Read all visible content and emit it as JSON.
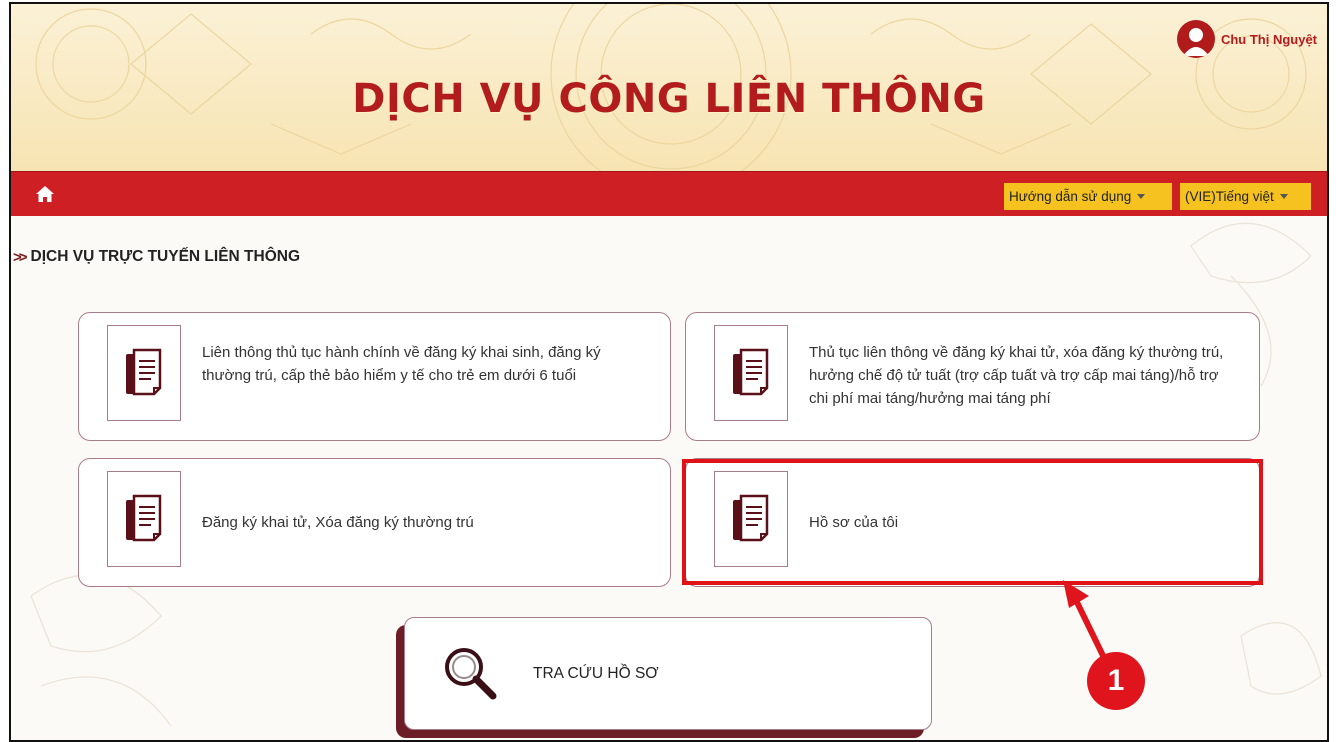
{
  "header": {
    "site_title": "DỊCH VỤ CÔNG LIÊN THÔNG",
    "user_name": "Chu Thị Nguyệt"
  },
  "navbar": {
    "home_icon": "home-icon",
    "guide_label": "Hướng dẫn sử dụng",
    "language_label": "(VIE)Tiếng việt"
  },
  "section": {
    "title": "DỊCH VỤ TRỰC TUYẾN LIÊN THÔNG"
  },
  "services": [
    {
      "label": "Liên thông thủ tục hành chính về đăng ký khai sinh, đăng ký thường trú, cấp thẻ bảo hiểm y tế cho trẻ em dưới 6 tuổi",
      "icon": "document-icon"
    },
    {
      "label": "Thủ tục liên thông về đăng ký khai tử, xóa đăng ký thường trú, hưởng chế độ tử tuất (trợ cấp tuất và trợ cấp mai táng)/hỗ trợ chi phí mai táng/hưởng mai táng phí",
      "icon": "document-icon"
    },
    {
      "label": "Đăng ký khai tử, Xóa đăng ký thường trú",
      "icon": "document-icon"
    },
    {
      "label": "Hồ sơ của tôi",
      "icon": "document-icon"
    }
  ],
  "search_card": {
    "label": "TRA CỨU HỒ SƠ",
    "icon": "magnifier-icon"
  },
  "annotation": {
    "step_number": "1"
  },
  "colors": {
    "brand_red": "#cd1f24",
    "dropdown_yellow": "#f6c21f",
    "card_border": "#a87d8a",
    "highlight_red": "#e01218"
  }
}
